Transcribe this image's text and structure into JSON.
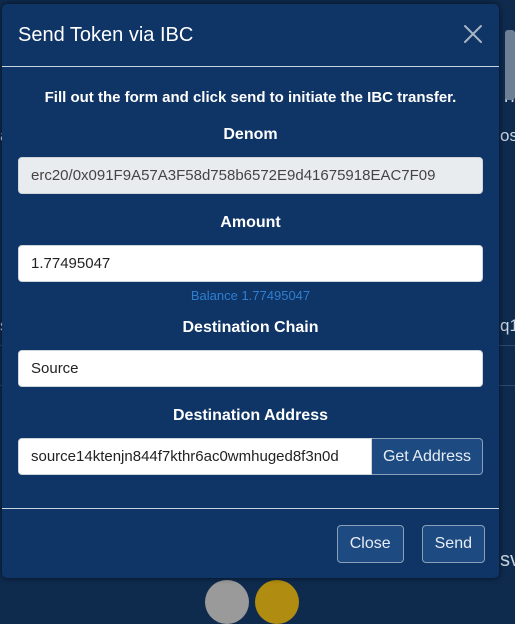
{
  "background": {
    "frag_right_1": "n",
    "frag_right_2": "os",
    "frag_right_3": "q1",
    "frag_left_1": "a",
    "frag_left_2": "s",
    "frag_right_4": "sv"
  },
  "modal": {
    "title": "Send Token via IBC",
    "intro": "Fill out the form and click send to initiate the IBC transfer.",
    "denom_label": "Denom",
    "denom_value": "erc20/0x091F9A57A3F58d758b6572E9d41675918EAC7F09",
    "amount_label": "Amount",
    "amount_value": "1.77495047",
    "balance_text": "Balance 1.77495047",
    "destination_chain_label": "Destination Chain",
    "destination_chain_value": "Source",
    "destination_address_label": "Destination Address",
    "destination_address_value": "source14ktenjn844f7kthr6ac0wmhuged8f3n0d",
    "get_address_label": "Get Address",
    "close_label": "Close",
    "send_label": "Send"
  },
  "icons": {
    "close": "close-icon"
  }
}
